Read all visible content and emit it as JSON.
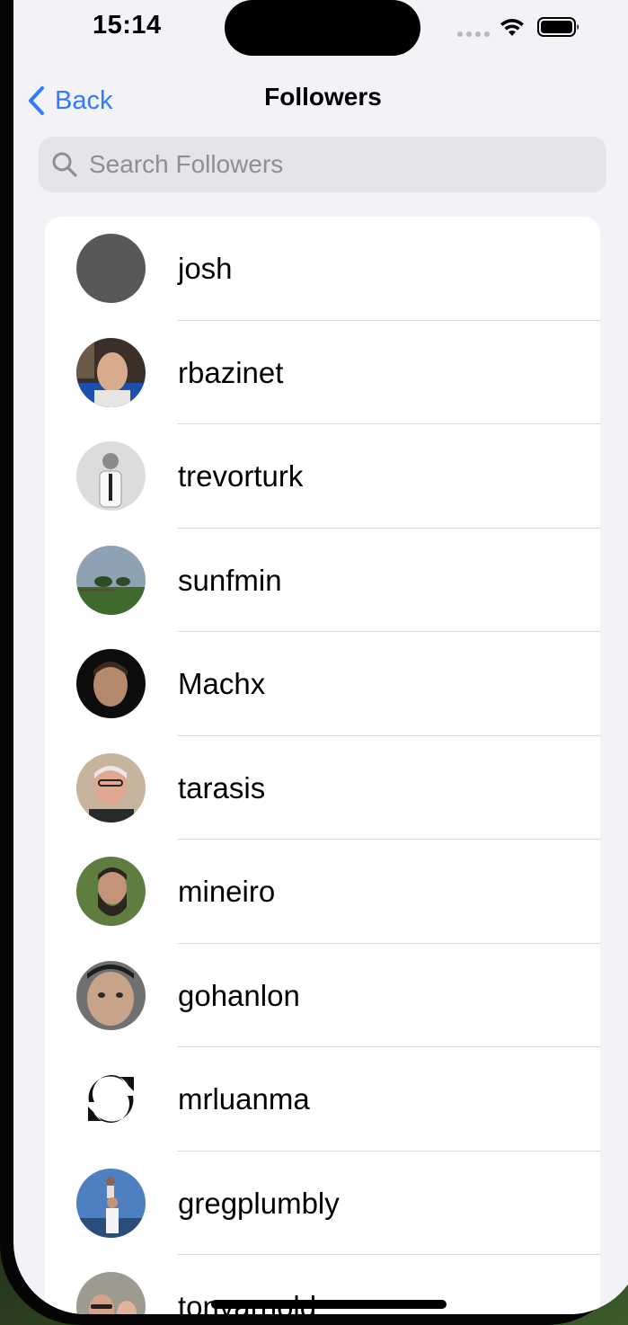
{
  "status_bar": {
    "time": "15:14",
    "wifi_icon": "wifi-icon",
    "battery_icon": "battery-icon"
  },
  "nav": {
    "back_label": "Back",
    "title": "Followers"
  },
  "search": {
    "placeholder": "Search Followers",
    "value": ""
  },
  "followers": [
    {
      "username": "josh"
    },
    {
      "username": "rbazinet"
    },
    {
      "username": "trevorturk"
    },
    {
      "username": "sunfmin"
    },
    {
      "username": "Machx"
    },
    {
      "username": "tarasis"
    },
    {
      "username": "mineiro"
    },
    {
      "username": "gohanlon"
    },
    {
      "username": "mrluanma"
    },
    {
      "username": "gregplumbly"
    },
    {
      "username": "tonyarnold"
    }
  ],
  "colors": {
    "accent": "#2f7cf6",
    "background": "#f2f2f7",
    "card": "#ffffff",
    "separator": "#d9d9de",
    "placeholder": "#8e8e93"
  }
}
